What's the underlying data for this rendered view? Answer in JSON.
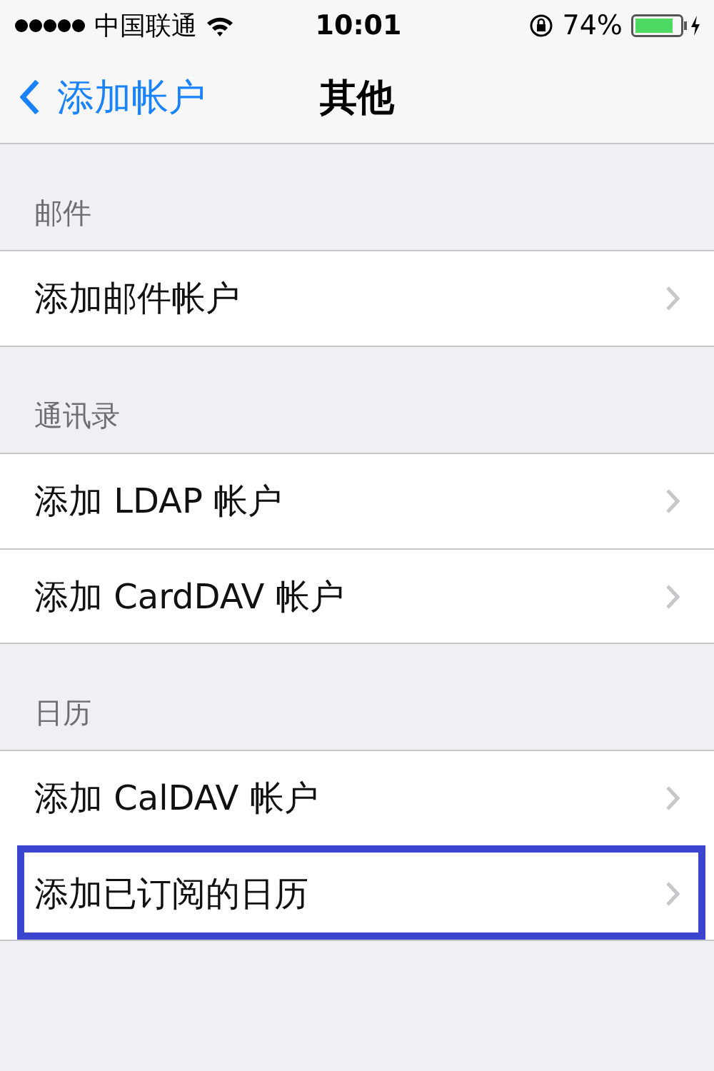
{
  "status_bar": {
    "carrier": "中国联通",
    "time": "10:01",
    "battery": "74%"
  },
  "nav": {
    "back": "添加帐户",
    "title": "其他"
  },
  "sections": [
    {
      "header": "邮件",
      "items": [
        {
          "label": "添加邮件帐户",
          "highlighted": false
        }
      ]
    },
    {
      "header": "通讯录",
      "items": [
        {
          "label": "添加 LDAP 帐户",
          "highlighted": false
        },
        {
          "label": "添加 CardDAV 帐户",
          "highlighted": false
        }
      ]
    },
    {
      "header": "日历",
      "items": [
        {
          "label": "添加 CalDAV 帐户",
          "highlighted": false
        },
        {
          "label": "添加已订阅的日历",
          "highlighted": true
        }
      ]
    }
  ]
}
